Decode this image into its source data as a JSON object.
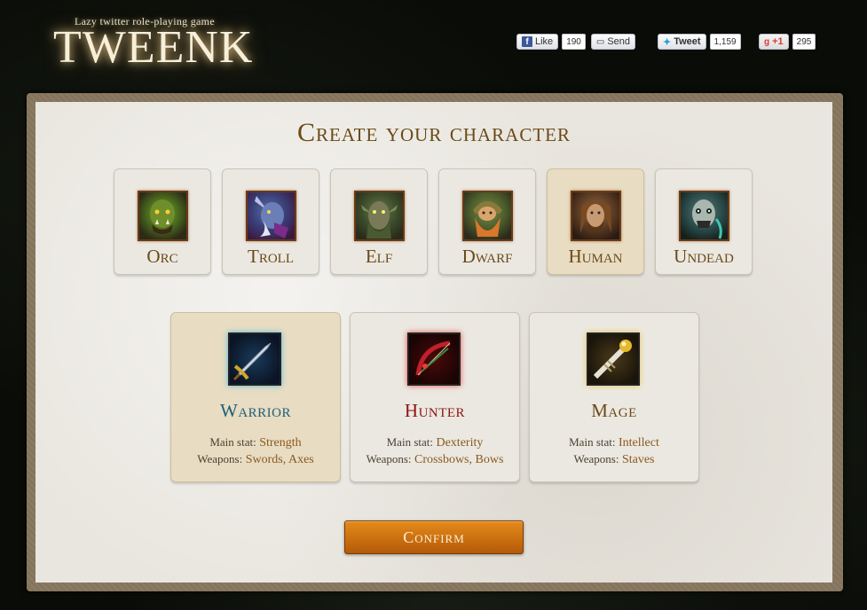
{
  "header": {
    "tagline": "Lazy twitter role-playing game",
    "title": "TWEENK"
  },
  "social": {
    "facebook": {
      "like_label": "Like",
      "like_count": "190",
      "send_label": "Send"
    },
    "twitter": {
      "tweet_label": "Tweet",
      "tweet_count": "1,159"
    },
    "google": {
      "plus_label": "+1",
      "plus_count": "295"
    }
  },
  "main": {
    "title": "Create your character",
    "races": [
      {
        "label": "Orc",
        "icon": "orc-portrait"
      },
      {
        "label": "Troll",
        "icon": "troll-portrait"
      },
      {
        "label": "Elf",
        "icon": "elf-portrait"
      },
      {
        "label": "Dwarf",
        "icon": "dwarf-portrait"
      },
      {
        "label": "Human",
        "icon": "human-portrait",
        "selected": true
      },
      {
        "label": "Undead",
        "icon": "undead-portrait"
      }
    ],
    "classes": [
      {
        "name": "Warrior",
        "color": "#1f5f78",
        "main_stat_label": "Main stat:",
        "main_stat": "Strength",
        "weapons_label": "Weapons:",
        "weapons": "Swords, Axes",
        "icon": "sword-icon",
        "selected": true
      },
      {
        "name": "Hunter",
        "color": "#8a1414",
        "main_stat_label": "Main stat:",
        "main_stat": "Dexterity",
        "weapons_label": "Weapons:",
        "weapons": "Crossbows, Bows",
        "icon": "bow-icon"
      },
      {
        "name": "Mage",
        "color": "#6b4a18",
        "main_stat_label": "Main stat:",
        "main_stat": "Intellect",
        "weapons_label": "Weapons:",
        "weapons": "Staves",
        "icon": "staff-icon"
      }
    ],
    "confirm_label": "Confirm"
  },
  "colors": {
    "accent": "#6b4a18",
    "button": "#d37615",
    "warrior": "#1f5f78",
    "hunter": "#8a1414",
    "mage": "#6b4a18"
  }
}
